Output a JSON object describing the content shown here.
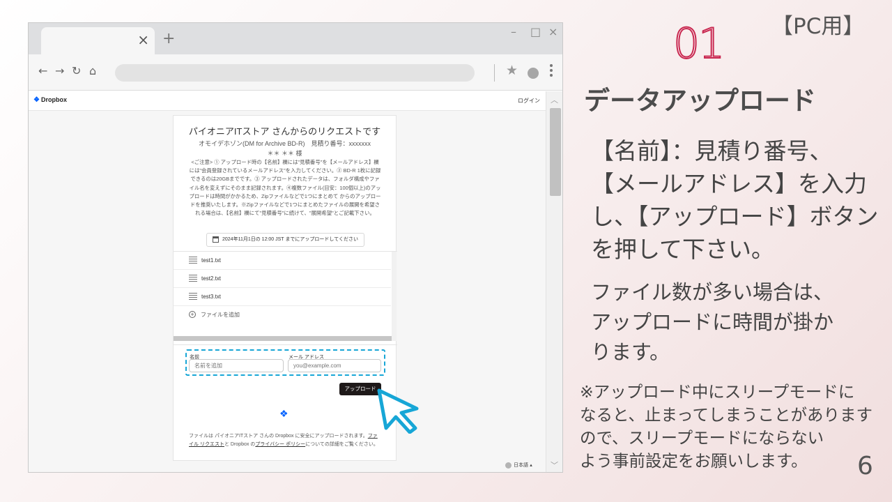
{
  "browser": {
    "tab_close": "×",
    "new_tab": "+",
    "window_controls": {
      "minimize": "–",
      "maximize": "□",
      "close": "×"
    },
    "nav": {
      "back": "←",
      "forward": "→",
      "reload": "↻",
      "home": "⌂"
    },
    "address_value": "",
    "star": "★"
  },
  "dropbox": {
    "logo_text": "Dropbox",
    "login_label": "ログイン",
    "card": {
      "title": "パイオニアITストア さんからのリクエストです",
      "subtitle": "オモイデホゾン(DM for Archive BD-R)　見積り番号：xxxxxxx",
      "recipient": "＊＊ ＊＊ 様",
      "note": "<ご注意> ① アップロード時の【名前】欄には\"見積番号\"を【メールアドレス】欄には\"会員登録されているメールアドレス\"を入力してください。② BD-R 1枚に記録できるのは20GBまでです。③ アップロードされたデータは、フォルダ構成やファイル名を変えずにそのまま記録されます。④複数ファイル(目安：100個以上)のアップロードは時間がかかるため、Zipファイルなどで1つにまとめて からのアップロードを推奨いたします。※Zipファイルなどで1つにまとめたファイルの展開を希望される場合は、【名前】欄にて\"見積番号\"に続けて、\"展開希望\"とご記載下さい。",
      "deadline": "2024年11月1日の 12:00 JST までにアップロードしてください",
      "files": [
        {
          "name": "test1.txt"
        },
        {
          "name": "test2.txt"
        },
        {
          "name": "test3.txt"
        }
      ],
      "add_file_label": "ファイルを追加",
      "name_label": "名前",
      "name_placeholder": "名前を追加",
      "email_label": "メール アドレス",
      "email_placeholder": "you@example.com",
      "upload_label": "アップロード",
      "footer_pre": "ファイルは パイオニアITストア さんの Dropbox に安全にアップロードされます。",
      "footer_link1": "ファイル リクエスト",
      "footer_mid": "と Dropbox の",
      "footer_link2": "プライバシー ポリシー",
      "footer_post": "についての詳細をご覧ください。"
    },
    "language": "日本語 ▴"
  },
  "slide": {
    "number": "01",
    "tag": "【PC用】",
    "heading": "データアップロード",
    "instruction_lines": [
      "【名前】：見積り番号、",
      "【メールアドレス】を入力",
      "し、【アップロード】ボタン",
      "を押して下さい。"
    ],
    "note_lines": [
      "ファイル数が多い場合は、",
      "アップロードに時間が掛か",
      "ります。"
    ],
    "warning_lines": [
      "※アップロード中にスリープモードに",
      "なると、止まってしまうことがあります",
      "ので、スリープモードにならない",
      "よう事前設定をお願いします。"
    ],
    "page_number": "6"
  },
  "colors": {
    "accent_red": "#c8274f",
    "highlight_blue": "#17a6d6",
    "dropbox_blue": "#0061fe"
  }
}
